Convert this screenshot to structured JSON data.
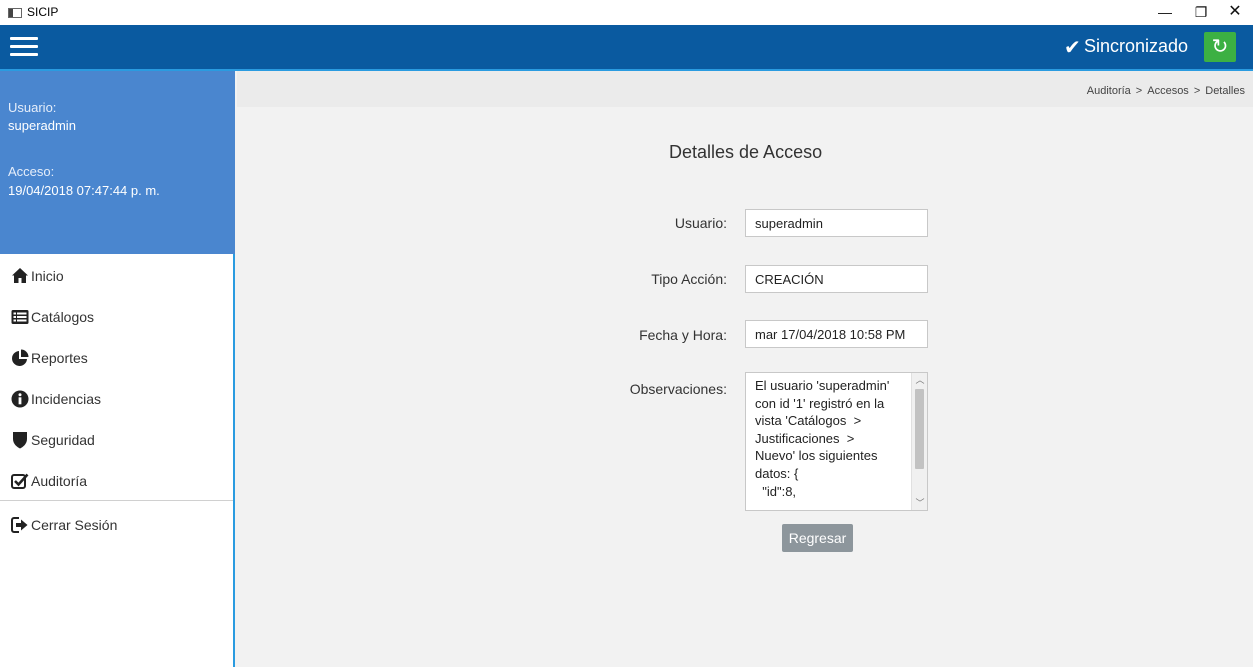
{
  "window": {
    "title": "SICIP",
    "min_glyph": "—",
    "max_glyph": "❐",
    "close_glyph": "✕"
  },
  "header": {
    "sync_check": "✔",
    "sync_text": "Sincronizado",
    "sync_button_glyph": "↻",
    "sync_color": "#3cb043",
    "bar_color": "#0a5aa0"
  },
  "sidebar": {
    "user_label": "Usuario:",
    "user_value": "superadmin",
    "access_label": "Acceso:",
    "access_value": "19/04/2018 07:47:44 p. m.",
    "box_color": "#4a86cf",
    "items": [
      {
        "label": "Inicio",
        "icon": "home-icon"
      },
      {
        "label": "Catálogos",
        "icon": "list-icon"
      },
      {
        "label": "Reportes",
        "icon": "pie-chart-icon"
      },
      {
        "label": "Incidencias",
        "icon": "info-icon"
      },
      {
        "label": "Seguridad",
        "icon": "shield-icon"
      },
      {
        "label": "Auditoría",
        "icon": "check-square-icon"
      },
      {
        "label": "Cerrar Sesión",
        "icon": "sign-out-icon"
      }
    ]
  },
  "breadcrumb": {
    "items": [
      "Auditoría",
      "Accesos",
      "Detalles"
    ],
    "separator": ">"
  },
  "main": {
    "title": "Detalles de Acceso",
    "usuario_label": "Usuario:",
    "usuario_value": "superadmin",
    "tipo_label": "Tipo Acción:",
    "tipo_value": "CREACIÓN",
    "fecha_label": "Fecha y Hora:",
    "fecha_value": "mar 17/04/2018 10:58 PM",
    "obs_label": "Observaciones:",
    "obs_value": "El usuario 'superadmin'\ncon id '1' registró en la\nvista 'Catálogos  >\nJustificaciones  >\nNuevo' los siguientes\ndatos: {\n  \"id\":8,",
    "back_button": "Regresar"
  }
}
